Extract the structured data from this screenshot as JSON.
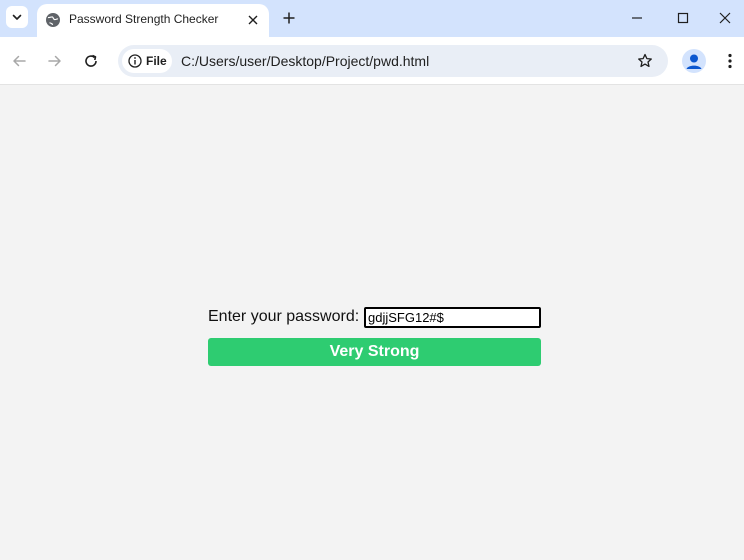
{
  "browser": {
    "tab": {
      "title": "Password Strength Checker",
      "favicon": "globe-icon"
    },
    "window_controls": [
      "minimize-icon",
      "maximize-icon",
      "close-icon"
    ],
    "address_bar": {
      "chip_label": "File",
      "url": "C:/Users/user/Desktop/Project/pwd.html"
    }
  },
  "page": {
    "password_label": "Enter your password:",
    "password_value": "gdjjSFG12#$",
    "strength_text": "Very Strong",
    "strength_color": "#2ecc71",
    "background_color": "#f3f3f3"
  }
}
